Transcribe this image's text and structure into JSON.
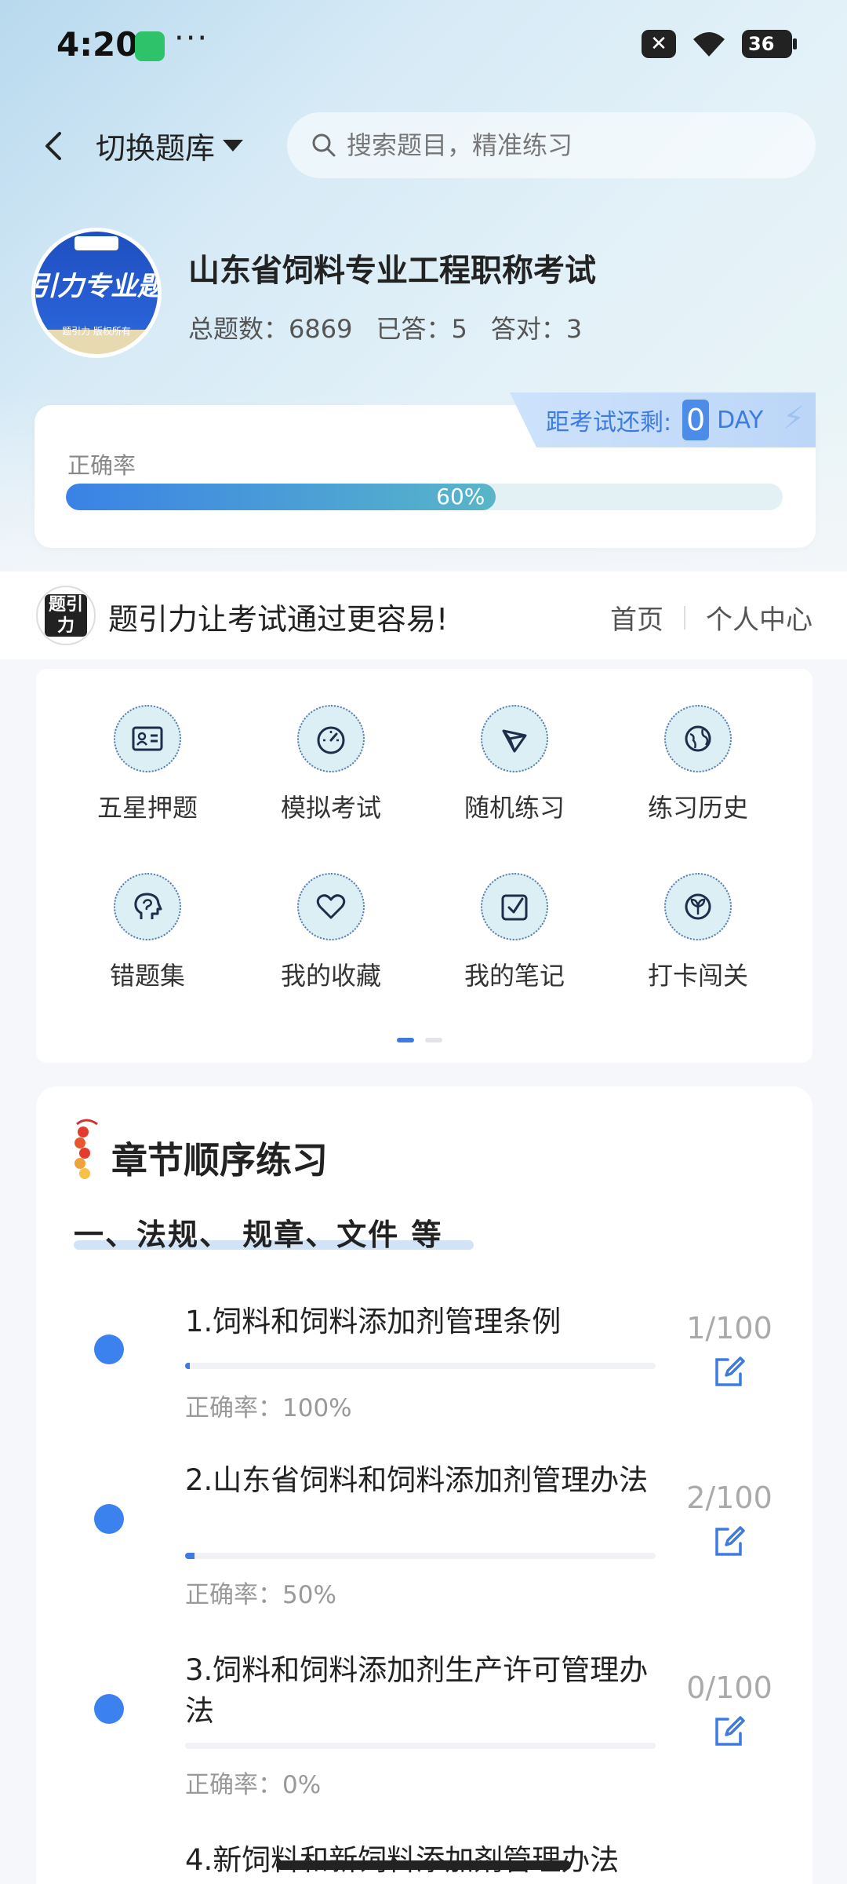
{
  "status_bar": {
    "time": "4:20",
    "dots": "···",
    "x_label": "✕",
    "battery": "36"
  },
  "header": {
    "switch_label": "切换题库",
    "search_placeholder": "搜索题目，精准练习"
  },
  "bank": {
    "logo_text": "引力专业题",
    "logo_sub": "题引力 版权所有",
    "title": "山东省饲料专业工程职称考试",
    "total_label": "总题数：6869",
    "answered_label": "已答：5",
    "correct_label": "答对：3"
  },
  "exam": {
    "countdown_label": "距考试还剩:",
    "days": "0",
    "unit": "DAY"
  },
  "accuracy": {
    "label": "正确率",
    "percent_text": "60%",
    "value": 0.6
  },
  "slogan": {
    "logo_text": "题引力",
    "text": "题引力让考试通过更容易!",
    "nav_home": "首页",
    "nav_profile": "个人中心"
  },
  "features": [
    {
      "label": "五星押题",
      "icon": "id-card-icon"
    },
    {
      "label": "模拟考试",
      "icon": "speedometer-icon"
    },
    {
      "label": "随机练习",
      "icon": "shuffle-network-icon"
    },
    {
      "label": "练习历史",
      "icon": "globe-icon"
    },
    {
      "label": "错题集",
      "icon": "head-brain-icon"
    },
    {
      "label": "我的收藏",
      "icon": "heart-icon"
    },
    {
      "label": "我的笔记",
      "icon": "note-check-icon"
    },
    {
      "label": "打卡闯关",
      "icon": "leaf-badge-icon"
    }
  ],
  "chapters": {
    "title": "章节顺序练习",
    "section_title": "一、法规、 规章、文件 等",
    "items": [
      {
        "name": "1.饲料和饲料添加剂管理条例",
        "rate": "正确率：100%",
        "count": "1/100",
        "progress": 0.01
      },
      {
        "name": "2.山东省饲料和饲料添加剂管理办法",
        "rate": "正确率：50%",
        "count": "2/100",
        "progress": 0.02
      },
      {
        "name": "3.饲料和饲料添加剂生产许可管理办 法",
        "rate": "正确率：0%",
        "count": "0/100",
        "progress": 0
      },
      {
        "name": "4.新饲料和新饲料添加剂管理办法",
        "rate": "",
        "count": "",
        "progress": 0
      }
    ]
  },
  "colors": {
    "accent": "#3d7be0",
    "dot": "#3c82ef",
    "progress_end": "#58b6c8"
  }
}
